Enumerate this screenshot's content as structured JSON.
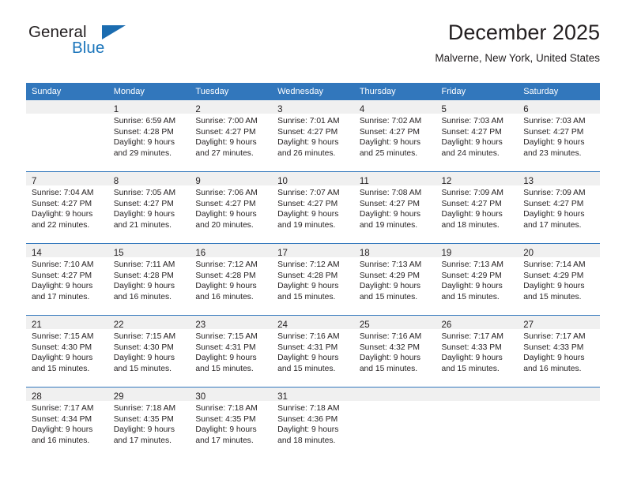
{
  "logo": {
    "primary_text": "General",
    "secondary_text": "Blue",
    "primary_color": "#231f20",
    "secondary_color": "#1b75bb",
    "triangle_color": "#1b6cb0"
  },
  "header": {
    "title": "December 2025",
    "subtitle": "Malverne, New York, United States"
  },
  "theme": {
    "header_bg": "#3277bc",
    "daynum_band_bg": "#f0f0f0",
    "grid_line": "#3277bc",
    "text": "#231f20"
  },
  "calendar": {
    "weekday_headers": [
      "Sunday",
      "Monday",
      "Tuesday",
      "Wednesday",
      "Thursday",
      "Friday",
      "Saturday"
    ],
    "weeks": [
      [
        {
          "day": "",
          "sunrise": "",
          "sunset": "",
          "daylight_line1": "",
          "daylight_line2": "",
          "empty": true
        },
        {
          "day": "1",
          "sunrise": "Sunrise: 6:59 AM",
          "sunset": "Sunset: 4:28 PM",
          "daylight_line1": "Daylight: 9 hours",
          "daylight_line2": "and 29 minutes.",
          "empty": false
        },
        {
          "day": "2",
          "sunrise": "Sunrise: 7:00 AM",
          "sunset": "Sunset: 4:27 PM",
          "daylight_line1": "Daylight: 9 hours",
          "daylight_line2": "and 27 minutes.",
          "empty": false
        },
        {
          "day": "3",
          "sunrise": "Sunrise: 7:01 AM",
          "sunset": "Sunset: 4:27 PM",
          "daylight_line1": "Daylight: 9 hours",
          "daylight_line2": "and 26 minutes.",
          "empty": false
        },
        {
          "day": "4",
          "sunrise": "Sunrise: 7:02 AM",
          "sunset": "Sunset: 4:27 PM",
          "daylight_line1": "Daylight: 9 hours",
          "daylight_line2": "and 25 minutes.",
          "empty": false
        },
        {
          "day": "5",
          "sunrise": "Sunrise: 7:03 AM",
          "sunset": "Sunset: 4:27 PM",
          "daylight_line1": "Daylight: 9 hours",
          "daylight_line2": "and 24 minutes.",
          "empty": false
        },
        {
          "day": "6",
          "sunrise": "Sunrise: 7:03 AM",
          "sunset": "Sunset: 4:27 PM",
          "daylight_line1": "Daylight: 9 hours",
          "daylight_line2": "and 23 minutes.",
          "empty": false
        }
      ],
      [
        {
          "day": "7",
          "sunrise": "Sunrise: 7:04 AM",
          "sunset": "Sunset: 4:27 PM",
          "daylight_line1": "Daylight: 9 hours",
          "daylight_line2": "and 22 minutes.",
          "empty": false
        },
        {
          "day": "8",
          "sunrise": "Sunrise: 7:05 AM",
          "sunset": "Sunset: 4:27 PM",
          "daylight_line1": "Daylight: 9 hours",
          "daylight_line2": "and 21 minutes.",
          "empty": false
        },
        {
          "day": "9",
          "sunrise": "Sunrise: 7:06 AM",
          "sunset": "Sunset: 4:27 PM",
          "daylight_line1": "Daylight: 9 hours",
          "daylight_line2": "and 20 minutes.",
          "empty": false
        },
        {
          "day": "10",
          "sunrise": "Sunrise: 7:07 AM",
          "sunset": "Sunset: 4:27 PM",
          "daylight_line1": "Daylight: 9 hours",
          "daylight_line2": "and 19 minutes.",
          "empty": false
        },
        {
          "day": "11",
          "sunrise": "Sunrise: 7:08 AM",
          "sunset": "Sunset: 4:27 PM",
          "daylight_line1": "Daylight: 9 hours",
          "daylight_line2": "and 19 minutes.",
          "empty": false
        },
        {
          "day": "12",
          "sunrise": "Sunrise: 7:09 AM",
          "sunset": "Sunset: 4:27 PM",
          "daylight_line1": "Daylight: 9 hours",
          "daylight_line2": "and 18 minutes.",
          "empty": false
        },
        {
          "day": "13",
          "sunrise": "Sunrise: 7:09 AM",
          "sunset": "Sunset: 4:27 PM",
          "daylight_line1": "Daylight: 9 hours",
          "daylight_line2": "and 17 minutes.",
          "empty": false
        }
      ],
      [
        {
          "day": "14",
          "sunrise": "Sunrise: 7:10 AM",
          "sunset": "Sunset: 4:27 PM",
          "daylight_line1": "Daylight: 9 hours",
          "daylight_line2": "and 17 minutes.",
          "empty": false
        },
        {
          "day": "15",
          "sunrise": "Sunrise: 7:11 AM",
          "sunset": "Sunset: 4:28 PM",
          "daylight_line1": "Daylight: 9 hours",
          "daylight_line2": "and 16 minutes.",
          "empty": false
        },
        {
          "day": "16",
          "sunrise": "Sunrise: 7:12 AM",
          "sunset": "Sunset: 4:28 PM",
          "daylight_line1": "Daylight: 9 hours",
          "daylight_line2": "and 16 minutes.",
          "empty": false
        },
        {
          "day": "17",
          "sunrise": "Sunrise: 7:12 AM",
          "sunset": "Sunset: 4:28 PM",
          "daylight_line1": "Daylight: 9 hours",
          "daylight_line2": "and 15 minutes.",
          "empty": false
        },
        {
          "day": "18",
          "sunrise": "Sunrise: 7:13 AM",
          "sunset": "Sunset: 4:29 PM",
          "daylight_line1": "Daylight: 9 hours",
          "daylight_line2": "and 15 minutes.",
          "empty": false
        },
        {
          "day": "19",
          "sunrise": "Sunrise: 7:13 AM",
          "sunset": "Sunset: 4:29 PM",
          "daylight_line1": "Daylight: 9 hours",
          "daylight_line2": "and 15 minutes.",
          "empty": false
        },
        {
          "day": "20",
          "sunrise": "Sunrise: 7:14 AM",
          "sunset": "Sunset: 4:29 PM",
          "daylight_line1": "Daylight: 9 hours",
          "daylight_line2": "and 15 minutes.",
          "empty": false
        }
      ],
      [
        {
          "day": "21",
          "sunrise": "Sunrise: 7:15 AM",
          "sunset": "Sunset: 4:30 PM",
          "daylight_line1": "Daylight: 9 hours",
          "daylight_line2": "and 15 minutes.",
          "empty": false
        },
        {
          "day": "22",
          "sunrise": "Sunrise: 7:15 AM",
          "sunset": "Sunset: 4:30 PM",
          "daylight_line1": "Daylight: 9 hours",
          "daylight_line2": "and 15 minutes.",
          "empty": false
        },
        {
          "day": "23",
          "sunrise": "Sunrise: 7:15 AM",
          "sunset": "Sunset: 4:31 PM",
          "daylight_line1": "Daylight: 9 hours",
          "daylight_line2": "and 15 minutes.",
          "empty": false
        },
        {
          "day": "24",
          "sunrise": "Sunrise: 7:16 AM",
          "sunset": "Sunset: 4:31 PM",
          "daylight_line1": "Daylight: 9 hours",
          "daylight_line2": "and 15 minutes.",
          "empty": false
        },
        {
          "day": "25",
          "sunrise": "Sunrise: 7:16 AM",
          "sunset": "Sunset: 4:32 PM",
          "daylight_line1": "Daylight: 9 hours",
          "daylight_line2": "and 15 minutes.",
          "empty": false
        },
        {
          "day": "26",
          "sunrise": "Sunrise: 7:17 AM",
          "sunset": "Sunset: 4:33 PM",
          "daylight_line1": "Daylight: 9 hours",
          "daylight_line2": "and 15 minutes.",
          "empty": false
        },
        {
          "day": "27",
          "sunrise": "Sunrise: 7:17 AM",
          "sunset": "Sunset: 4:33 PM",
          "daylight_line1": "Daylight: 9 hours",
          "daylight_line2": "and 16 minutes.",
          "empty": false
        }
      ],
      [
        {
          "day": "28",
          "sunrise": "Sunrise: 7:17 AM",
          "sunset": "Sunset: 4:34 PM",
          "daylight_line1": "Daylight: 9 hours",
          "daylight_line2": "and 16 minutes.",
          "empty": false
        },
        {
          "day": "29",
          "sunrise": "Sunrise: 7:18 AM",
          "sunset": "Sunset: 4:35 PM",
          "daylight_line1": "Daylight: 9 hours",
          "daylight_line2": "and 17 minutes.",
          "empty": false
        },
        {
          "day": "30",
          "sunrise": "Sunrise: 7:18 AM",
          "sunset": "Sunset: 4:35 PM",
          "daylight_line1": "Daylight: 9 hours",
          "daylight_line2": "and 17 minutes.",
          "empty": false
        },
        {
          "day": "31",
          "sunrise": "Sunrise: 7:18 AM",
          "sunset": "Sunset: 4:36 PM",
          "daylight_line1": "Daylight: 9 hours",
          "daylight_line2": "and 18 minutes.",
          "empty": false
        },
        {
          "day": "",
          "sunrise": "",
          "sunset": "",
          "daylight_line1": "",
          "daylight_line2": "",
          "empty": true
        },
        {
          "day": "",
          "sunrise": "",
          "sunset": "",
          "daylight_line1": "",
          "daylight_line2": "",
          "empty": true
        },
        {
          "day": "",
          "sunrise": "",
          "sunset": "",
          "daylight_line1": "",
          "daylight_line2": "",
          "empty": true
        }
      ]
    ]
  }
}
